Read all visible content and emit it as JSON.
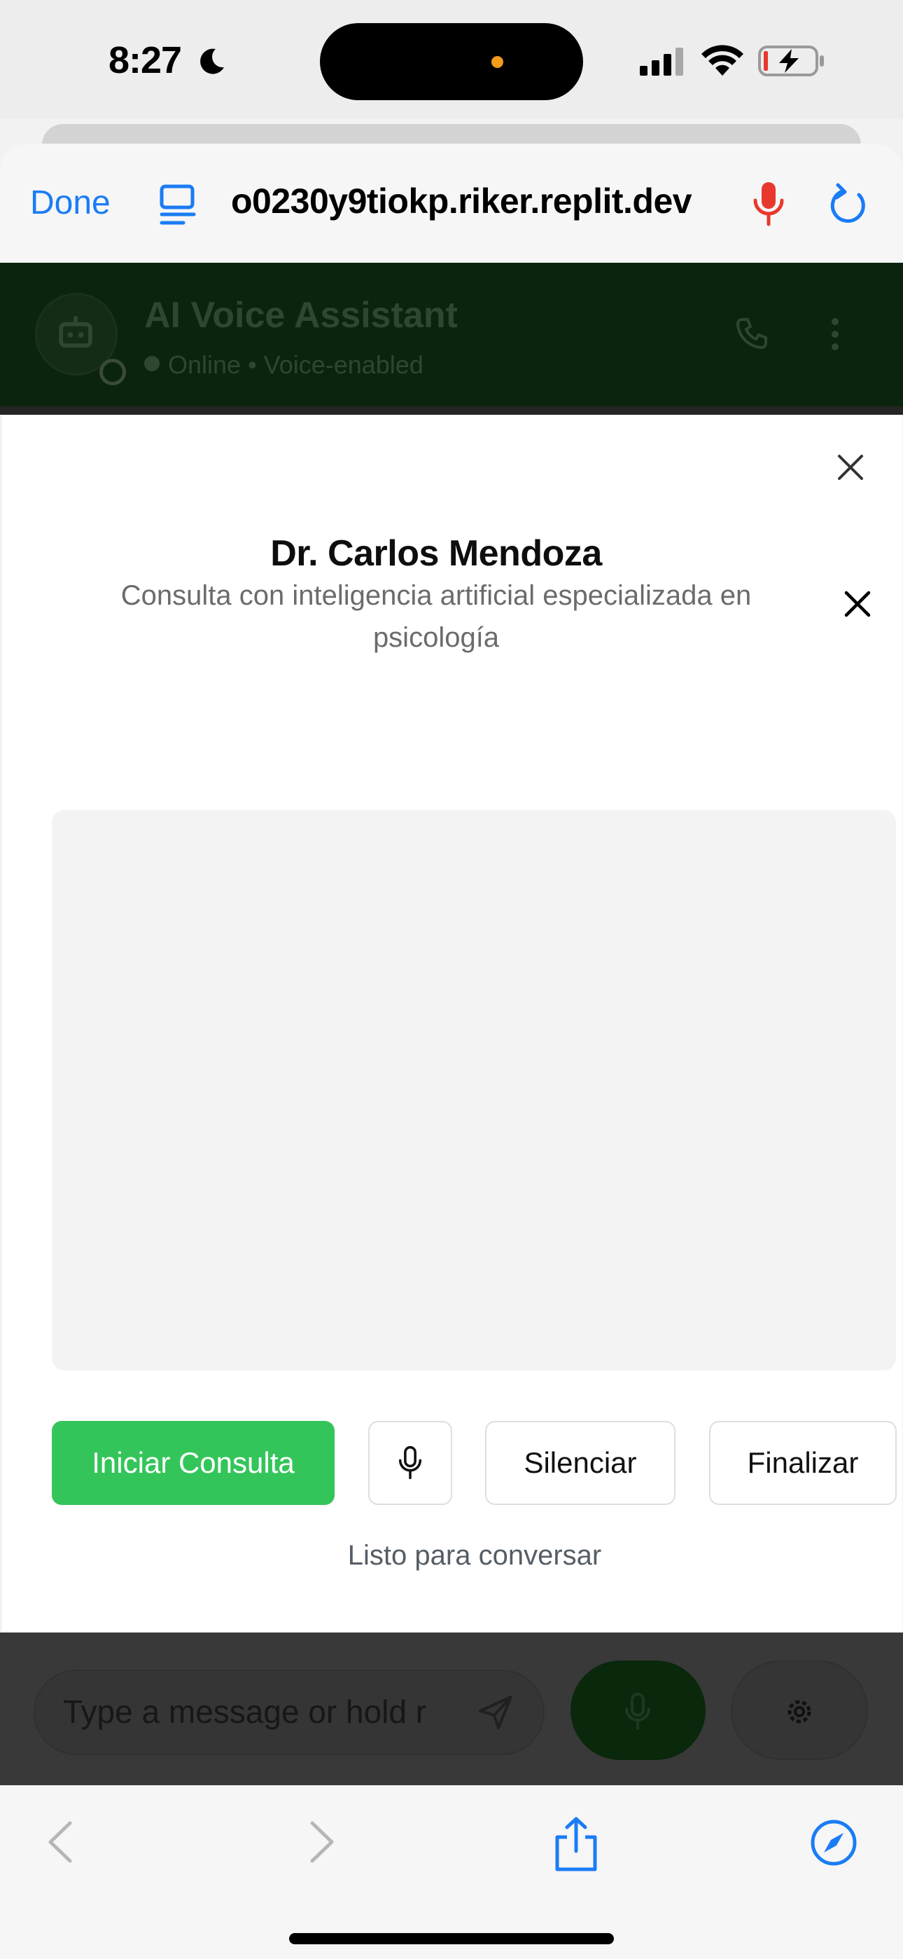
{
  "status_bar": {
    "time": "8:27",
    "icons": [
      "moon-icon",
      "signal-icon",
      "wifi-icon",
      "battery-charging-icon"
    ]
  },
  "safari_top": {
    "done_label": "Done",
    "url": "o0230y9tiokp.riker.replit.dev",
    "icons": [
      "reader-icon",
      "mic-icon",
      "reload-icon"
    ],
    "mic_color": "#e8382e",
    "accent_color": "#1a7cf5"
  },
  "app_header": {
    "title": "AI Voice Assistant",
    "subtitle": "Online • Voice-enabled"
  },
  "modal": {
    "title": "Dr. Carlos Mendoza",
    "description": "Consulta con inteligencia artificial especializada en psicología",
    "buttons": {
      "start": "Iniciar Consulta",
      "mute": "Silenciar",
      "end": "Finalizar"
    },
    "status": "Listo para conversar",
    "start_color": "#34c55a"
  },
  "input_bar": {
    "placeholder": "Type a message or hold r"
  }
}
